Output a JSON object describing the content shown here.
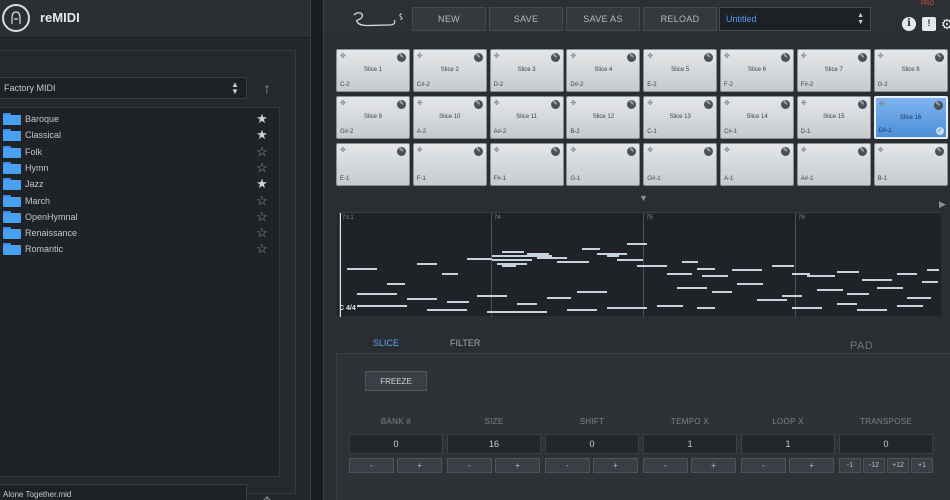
{
  "library": {
    "app_name": "reMIDI",
    "selected_library": "Factory MIDI",
    "folders": [
      {
        "label": "Baroque",
        "starred": true
      },
      {
        "label": "Classical",
        "starred": true
      },
      {
        "label": "Folk",
        "starred": false
      },
      {
        "label": "Hymn",
        "starred": false
      },
      {
        "label": "Jazz",
        "starred": true
      },
      {
        "label": "March",
        "starred": false
      },
      {
        "label": "OpenHymnal",
        "starred": false
      },
      {
        "label": "Renaissance",
        "starred": false
      },
      {
        "label": "Romantic",
        "starred": false
      }
    ],
    "current_file": "Alone Together.mid"
  },
  "toolbar": {
    "new_label": "NEW",
    "save_label": "SAVE",
    "save_as_label": "SAVE AS",
    "reload_label": "RELOAD",
    "preset_name": "Untitled",
    "red_tag": "PRO"
  },
  "pads": [
    {
      "label": "Slice 1",
      "note": "C-2"
    },
    {
      "label": "Slice 2",
      "note": "C#-2"
    },
    {
      "label": "Slice 3",
      "note": "D-2"
    },
    {
      "label": "Slice 4",
      "note": "D#-2"
    },
    {
      "label": "Slice 5",
      "note": "E-2"
    },
    {
      "label": "Slice 6",
      "note": "F-2"
    },
    {
      "label": "Slice 7",
      "note": "F#-2"
    },
    {
      "label": "Slice 8",
      "note": "G-2"
    },
    {
      "label": "Slice 9",
      "note": "G#-2"
    },
    {
      "label": "Slice 10",
      "note": "A-2"
    },
    {
      "label": "Slice 11",
      "note": "A#-2"
    },
    {
      "label": "Slice 12",
      "note": "B-2"
    },
    {
      "label": "Slice 13",
      "note": "C-1"
    },
    {
      "label": "Slice 14",
      "note": "C#-1"
    },
    {
      "label": "Slice 15",
      "note": "D-1"
    },
    {
      "label": "Slice 16",
      "note": "D#-1",
      "selected": true
    },
    {
      "label": "",
      "note": "E-1"
    },
    {
      "label": "",
      "note": "F-1"
    },
    {
      "label": "",
      "note": "F#-1"
    },
    {
      "label": "",
      "note": "G-1"
    },
    {
      "label": "",
      "note": "G#-1"
    },
    {
      "label": "",
      "note": "A-1"
    },
    {
      "label": "",
      "note": "A#-1"
    },
    {
      "label": "",
      "note": "B-1"
    }
  ],
  "roll": {
    "bar_labels": [
      "73.1",
      "74",
      "75",
      "76"
    ],
    "time_signature": "C 4/4"
  },
  "properties": {
    "tab_slice": "SLICE",
    "tab_filter": "FILTER",
    "title": "PAD PROPERTIES",
    "freeze_label": "FREEZE",
    "bank_label": "BANK #",
    "bank_value": "0",
    "size_label": "SIZE",
    "size_value": "16",
    "shift_label": "SHIFT",
    "shift_value": "0",
    "tempo_label": "TEMPO X",
    "tempo_value": "1",
    "loop_label": "LOOP X",
    "loop_value": "1",
    "transpose_label": "TRANSPOSE",
    "transpose_value": "0",
    "minus": "-",
    "plus": "+",
    "transpose_buttons": [
      "-1",
      "-12",
      "+12",
      "+1"
    ]
  },
  "colors": {
    "accent": "#5aa5f2",
    "selected_pad": "#4c8fd9",
    "folder": "#4aa0f0"
  }
}
